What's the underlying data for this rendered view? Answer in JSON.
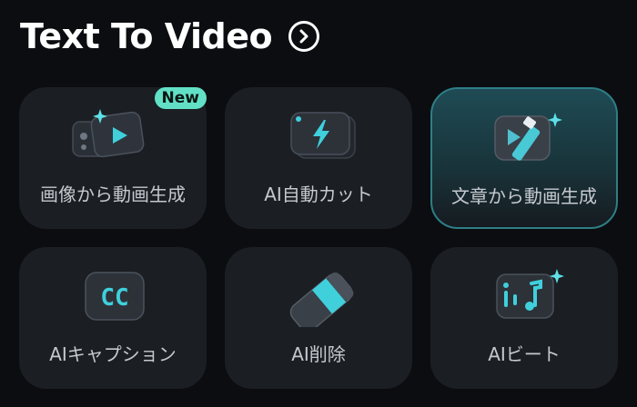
{
  "header": {
    "title": "Text To Video"
  },
  "cards": [
    {
      "label": "画像から動画生成",
      "badge": "New"
    },
    {
      "label": "AI自動カット"
    },
    {
      "label": "文章から動画生成"
    },
    {
      "label": "AIキャプション",
      "icon_text": "CC"
    },
    {
      "label": "AI削除"
    },
    {
      "label": "AIビート"
    }
  ],
  "colors": {
    "accent": "#3fd0dc",
    "badge": "#62e0c6",
    "card_bg": "#1b1e23",
    "active_border": "#2e7e86"
  }
}
